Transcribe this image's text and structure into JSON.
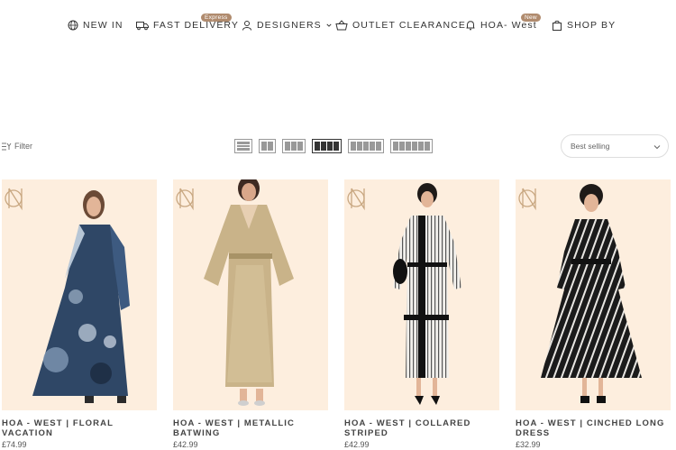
{
  "nav": {
    "items": [
      {
        "label": "NEW IN",
        "icon": "globe-icon"
      },
      {
        "label": "FAST DELIVERY",
        "icon": "truck-icon",
        "badge": "Express"
      },
      {
        "label": "DESIGNERS",
        "icon": "user-icon",
        "has_dropdown": true
      },
      {
        "label": "OUTLET CLEARANCE",
        "icon": "basket-icon"
      },
      {
        "label": "HOA- West",
        "icon": "bell-icon",
        "badge": "New"
      },
      {
        "label": "SHOP BY",
        "icon": "bag-icon"
      }
    ]
  },
  "toolbar": {
    "filter_label": "Filter",
    "sort_value": "Best selling",
    "view_options": [
      "list",
      "2-column",
      "3-column",
      "4-column",
      "5-column",
      "6-column"
    ],
    "active_view": "4-column"
  },
  "products": [
    {
      "title_line1": "HOA - WEST | FLORAL",
      "title_line2": "VACATION",
      "price": "£74.99"
    },
    {
      "title_line1": "HOA - WEST | METALLIC",
      "title_line2": "BATWING",
      "price": "£42.99"
    },
    {
      "title_line1": "HOA - WEST | COLLARED",
      "title_line2": "STRIPED",
      "price": "£42.99"
    },
    {
      "title_line1": "HOA - WEST | CINCHED LONG",
      "title_line2": "DRESS",
      "price": "£32.99"
    }
  ],
  "colors": {
    "accent_badge": "#b08b6e",
    "product_bg": "#fdeede"
  }
}
